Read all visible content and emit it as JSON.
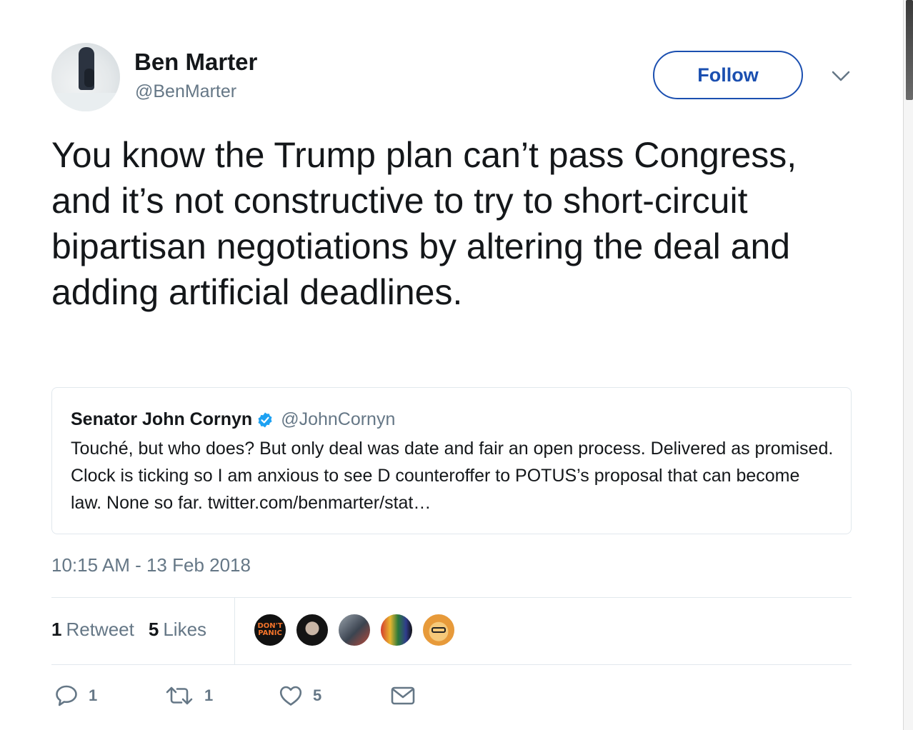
{
  "author": {
    "name": "Ben Marter",
    "handle": "@BenMarter"
  },
  "follow_label": "Follow",
  "tweet_text": "You know the Trump plan can’t pass Congress, and it’s not constructive to try to short-circuit bipartisan negotiations by altering the deal and adding artificial deadlines.",
  "quoted": {
    "name": "Senator John Cornyn",
    "handle": "@JohnCornyn",
    "text": "Touché, but who does?  But only deal was date and fair an open process. Delivered as promised.  Clock is ticking so I am anxious to see D counteroffer to POTUS’s proposal that can become law.  None so far. twitter.com/benmarter/stat…",
    "verified": true
  },
  "timestamp": "10:15 AM - 13 Feb 2018",
  "stats": {
    "retweets_count": "1",
    "retweets_label": "Retweet",
    "likes_count": "5",
    "likes_label": "Likes"
  },
  "likers_badge_text": "DON'T PANIC",
  "actions": {
    "reply_count": "1",
    "retweet_count": "1",
    "like_count": "5"
  },
  "colors": {
    "follow": "#1b4fb0",
    "secondary_text": "#657786",
    "verified": "#1da1f2"
  },
  "icons": [
    "chevron-down-icon",
    "verified-badge-icon",
    "reply-icon",
    "retweet-icon",
    "heart-icon",
    "envelope-icon"
  ]
}
